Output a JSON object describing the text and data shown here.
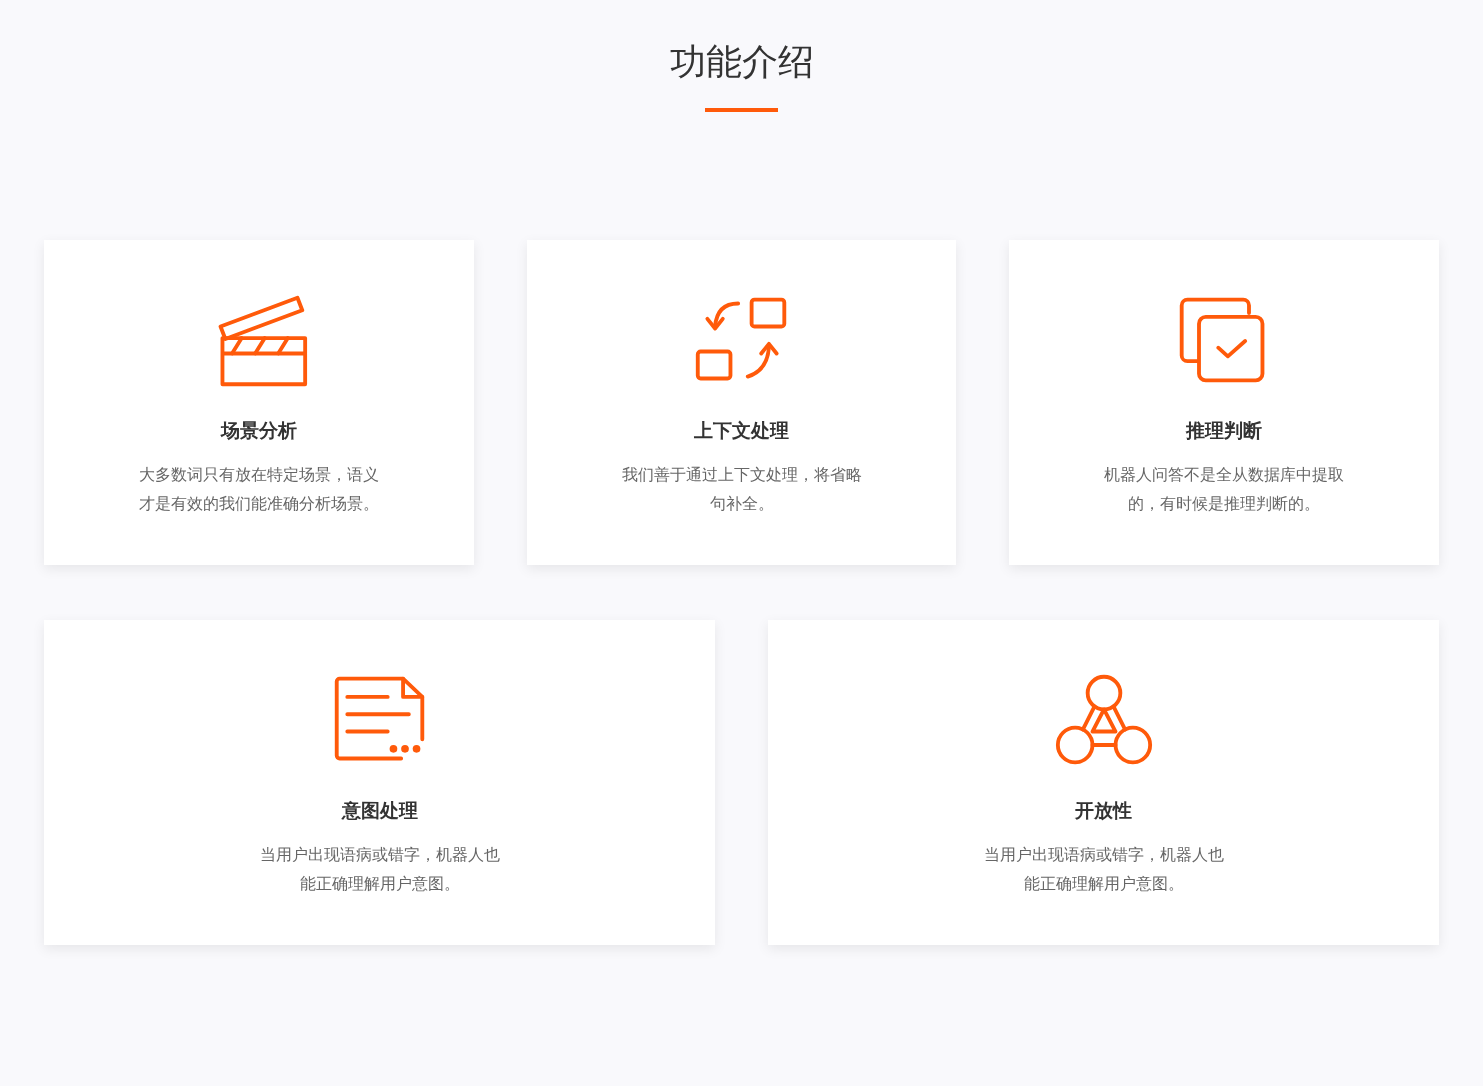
{
  "title": "功能介绍",
  "rows": [
    {
      "cards": [
        {
          "title": "场景分析",
          "description": "大多数词只有放在特定场景，语义才是有效的我们能准确分析场景。"
        },
        {
          "title": "上下文处理",
          "description": "我们善于通过上下文处理，将省略句补全。"
        },
        {
          "title": "推理判断",
          "description": "机器人问答不是全从数据库中提取的，有时候是推理判断的。"
        }
      ]
    },
    {
      "cards": [
        {
          "title": "意图处理",
          "description": "当用户出现语病或错字，机器人也能正确理解用户意图。"
        },
        {
          "title": "开放性",
          "description": "当用户出现语病或错字，机器人也能正确理解用户意图。"
        }
      ]
    }
  ]
}
